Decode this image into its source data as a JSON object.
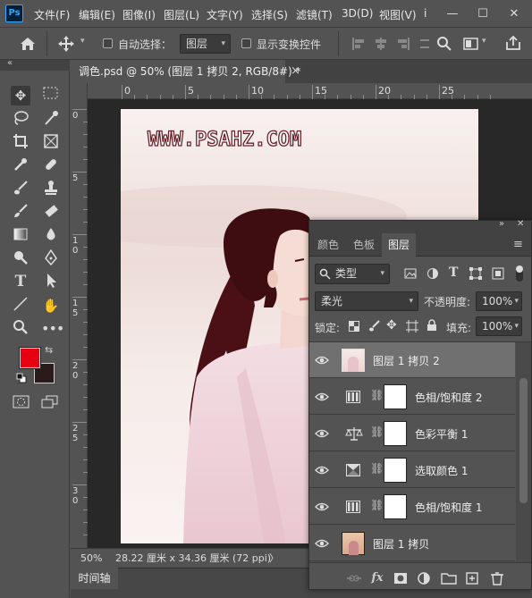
{
  "menubar": {
    "logo": "Ps",
    "items": [
      "文件(F)",
      "编辑(E)",
      "图像(I)",
      "图层(L)",
      "文字(Y)",
      "选择(S)",
      "滤镜(T)",
      "3D(D)",
      "视图(V)"
    ],
    "overflow_label": "ⅰ",
    "window_buttons": [
      "—",
      "☐",
      "✕"
    ]
  },
  "options": {
    "auto_select_label": "自动选择：",
    "auto_select_value": "图层",
    "show_transform_label": "显示变换控件"
  },
  "document": {
    "tab_title": "调色.psd @ 50% (图层 1 拷贝 2, RGB/8#) *",
    "tab_close": "×",
    "watermark": "WWW.PSAHZ.COM"
  },
  "rulers": {
    "h_labels": [
      "0",
      "5",
      "10",
      "15",
      "20",
      "25"
    ],
    "v_labels": [
      "0",
      "5",
      "1 0",
      "1 5",
      "2 0",
      "2 5",
      "3 0"
    ]
  },
  "status": {
    "zoom": "50%",
    "doc_size": "28.22 厘米 x 34.36 厘米 (72 ppi)",
    "arrow": "〉"
  },
  "timeline": {
    "label": "时间轴"
  },
  "layers_panel": {
    "tabs": [
      "颜色",
      "色板",
      "图层"
    ],
    "active_tab": "图层",
    "filter_kind": "类型",
    "blend_mode": "柔光",
    "opacity_label": "不透明度:",
    "opacity_value": "100%",
    "lock_label": "锁定:",
    "fill_label": "填充:",
    "fill_value": "100%",
    "layers": [
      {
        "name": "图层 1 拷贝 2",
        "kind": "pixel",
        "selected": true
      },
      {
        "name": "色相/饱和度 2",
        "kind": "hue-saturation-adjustment",
        "selected": false
      },
      {
        "name": "色彩平衡 1",
        "kind": "color-balance-adjustment",
        "selected": false
      },
      {
        "name": "选取颜色 1",
        "kind": "selective-color-adjustment",
        "selected": false
      },
      {
        "name": "色相/饱和度 1",
        "kind": "hue-saturation-adjustment",
        "selected": false
      },
      {
        "name": "图层 1 拷贝",
        "kind": "pixel",
        "selected": false
      }
    ]
  },
  "colors": {
    "foreground": "#e60012",
    "background": "#2a1a1a",
    "watermark_stroke": "#6a1f28"
  }
}
